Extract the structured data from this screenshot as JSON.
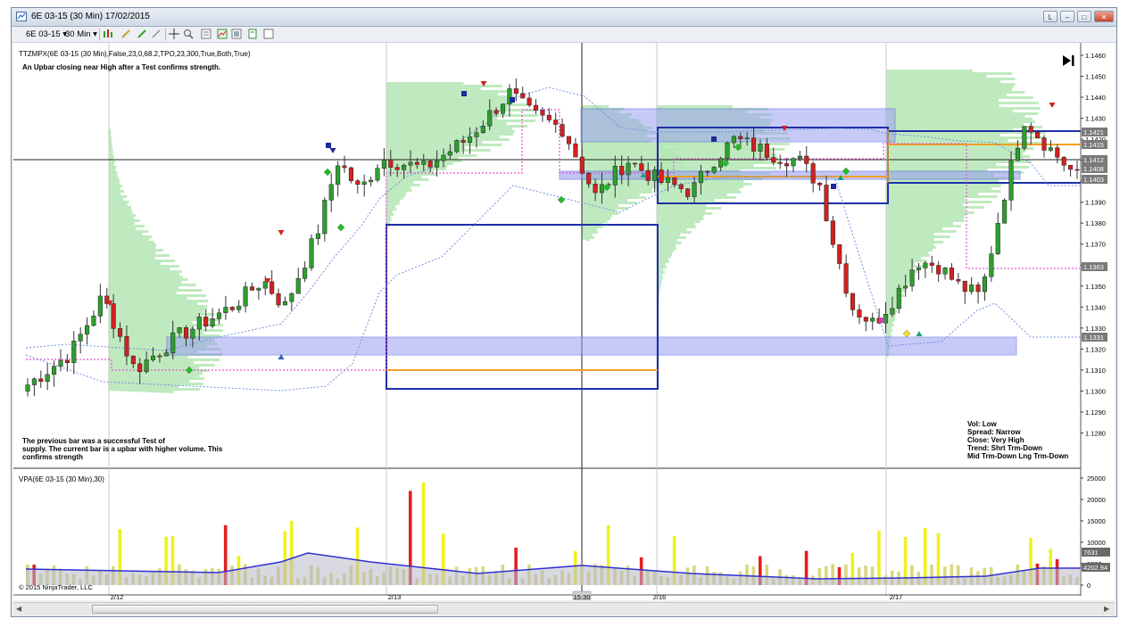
{
  "window": {
    "title": "6E 03-15 (30 Min)  17/02/2015",
    "controls": [
      "L",
      "–",
      "□",
      "✕"
    ]
  },
  "toolbar": {
    "instrument": "6E 03-15 ▾",
    "interval": "30 Min ▾"
  },
  "price_panel": {
    "indicator_label": "TTZMPX(6E 03-15 (30 Min),False,23,0,68.2,TPO,23,300,True,Both,True)",
    "top_note": "An Upbar closing near High after a Test confirms strength.",
    "bottom_note": [
      "The previous bar was a successful Test of",
      "supply. The current bar is a upbar with higher volume. This",
      "confirms strength"
    ],
    "analysis": [
      "Vol: Low",
      "Spread: Narrow",
      "Close: Very High",
      "Trend:  Shrt Trm-Down",
      "Mid Trm-Down  Lng Trm-Down"
    ],
    "y_ticks": [
      "1.1460",
      "1.1450",
      "1.1440",
      "1.1430",
      "1.1420",
      "1.1410",
      "1.1400",
      "1.1390",
      "1.1380",
      "1.1370",
      "1.1360",
      "1.1350",
      "1.1340",
      "1.1330",
      "1.1320",
      "1.1310",
      "1.1300",
      "1.1290",
      "1.1280"
    ],
    "price_tags": [
      "1.1421",
      "1.1415",
      "1.1412",
      "1.1408",
      "1.1403",
      "1.1363",
      "1.1331"
    ]
  },
  "volume_panel": {
    "indicator_label": "VPA(6E 03-15 (30 Min),30)",
    "copyright": "© 2015 NinjaTrader, LLC",
    "y_ticks": [
      "25000",
      "20000",
      "15000",
      "10000",
      "5000",
      "0"
    ],
    "value_tags": [
      "7631",
      "4202.94"
    ]
  },
  "x_axis": {
    "ticks": [
      "2/12",
      "2/13",
      "15:30",
      "2/16",
      "2/17"
    ]
  },
  "colors": {
    "up_candle": "#2e9e2e",
    "down_candle": "#d42020",
    "value_area": "#b4e6b4",
    "zone_fill": "#9aa0f0",
    "box_line": "#1e2fa8",
    "poc_line": "#f0a020",
    "vwap_dots": "#e850d0",
    "volume_ma": "#3030d0"
  }
}
